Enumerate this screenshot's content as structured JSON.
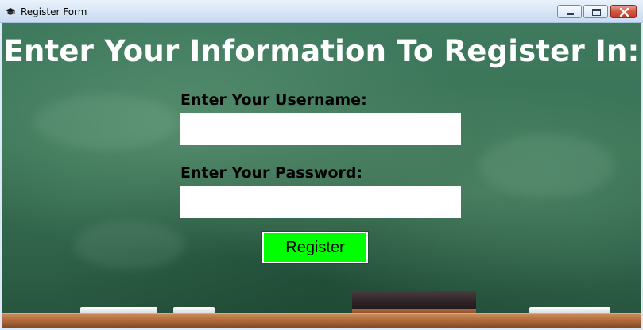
{
  "window": {
    "title": "Register Form",
    "icon": "graduation-cap-icon",
    "controls": [
      "minimize-icon",
      "maximize-icon",
      "close-icon"
    ]
  },
  "form": {
    "heading": "Enter Your Information To Register In:",
    "username_label": "Enter Your Username:",
    "username_value": "",
    "password_label": "Enter Your Password:",
    "password_value": "",
    "register_label": "Register"
  },
  "colors": {
    "board": "#3a7356",
    "register_button": "#00ff00",
    "heading_text": "#ffffff",
    "label_text": "#000000"
  }
}
